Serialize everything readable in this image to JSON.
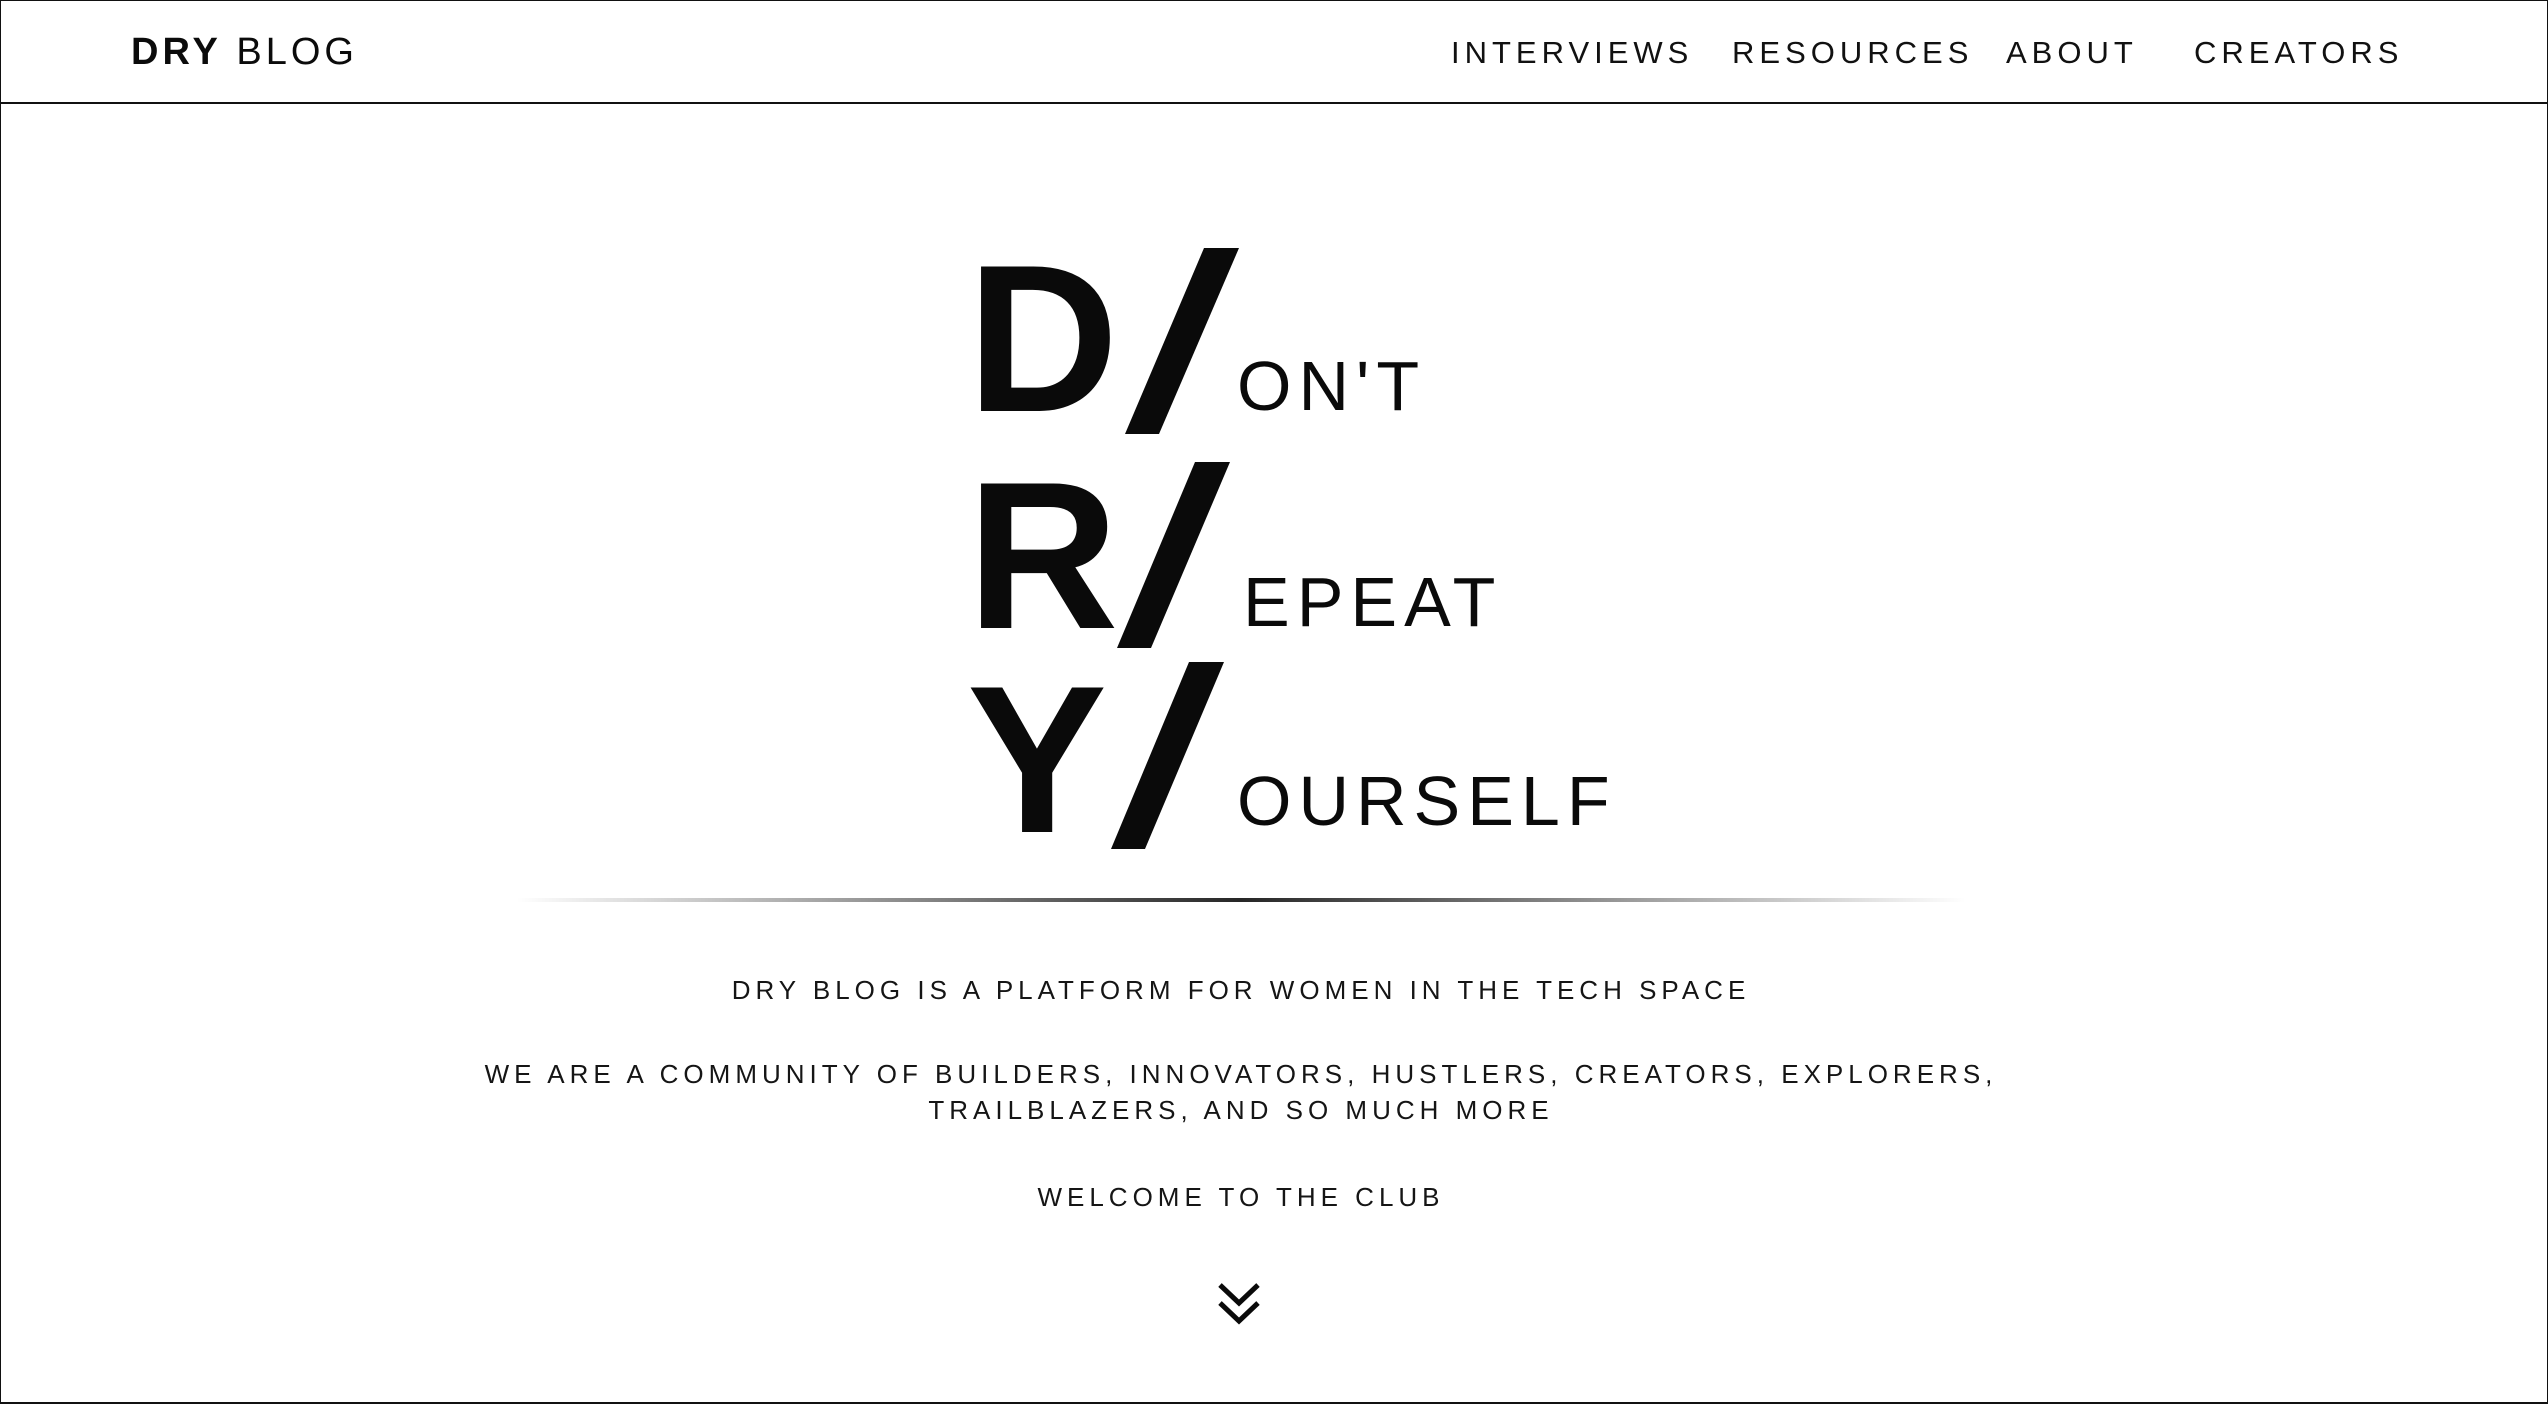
{
  "header": {
    "brand": {
      "strong": "DRY",
      "light": "BLOG"
    },
    "nav": [
      {
        "id": "interviews",
        "label": "INTERVIEWS"
      },
      {
        "id": "resources",
        "label": "RESOURCES"
      },
      {
        "id": "about",
        "label": "ABOUT"
      },
      {
        "id": "creators",
        "label": "CREATORS"
      }
    ]
  },
  "hero": {
    "lines": [
      {
        "letter": "D",
        "word": "ON'T"
      },
      {
        "letter": "R",
        "word": "EPEAT"
      },
      {
        "letter": "Y",
        "word": "OURSELF"
      }
    ]
  },
  "intro": {
    "tagline": "DRY BLOG IS A PLATFORM FOR WOMEN IN THE TECH SPACE",
    "community_line1": "WE ARE A COMMUNITY OF BUILDERS, INNOVATORS, HUSTLERS, CREATORS, EXPLORERS,",
    "community_line2": "TRAILBLAZERS, AND SO MUCH MORE",
    "welcome": "WELCOME TO THE CLUB"
  },
  "icons": {
    "scroll_down": "double-chevron-down-icon"
  }
}
